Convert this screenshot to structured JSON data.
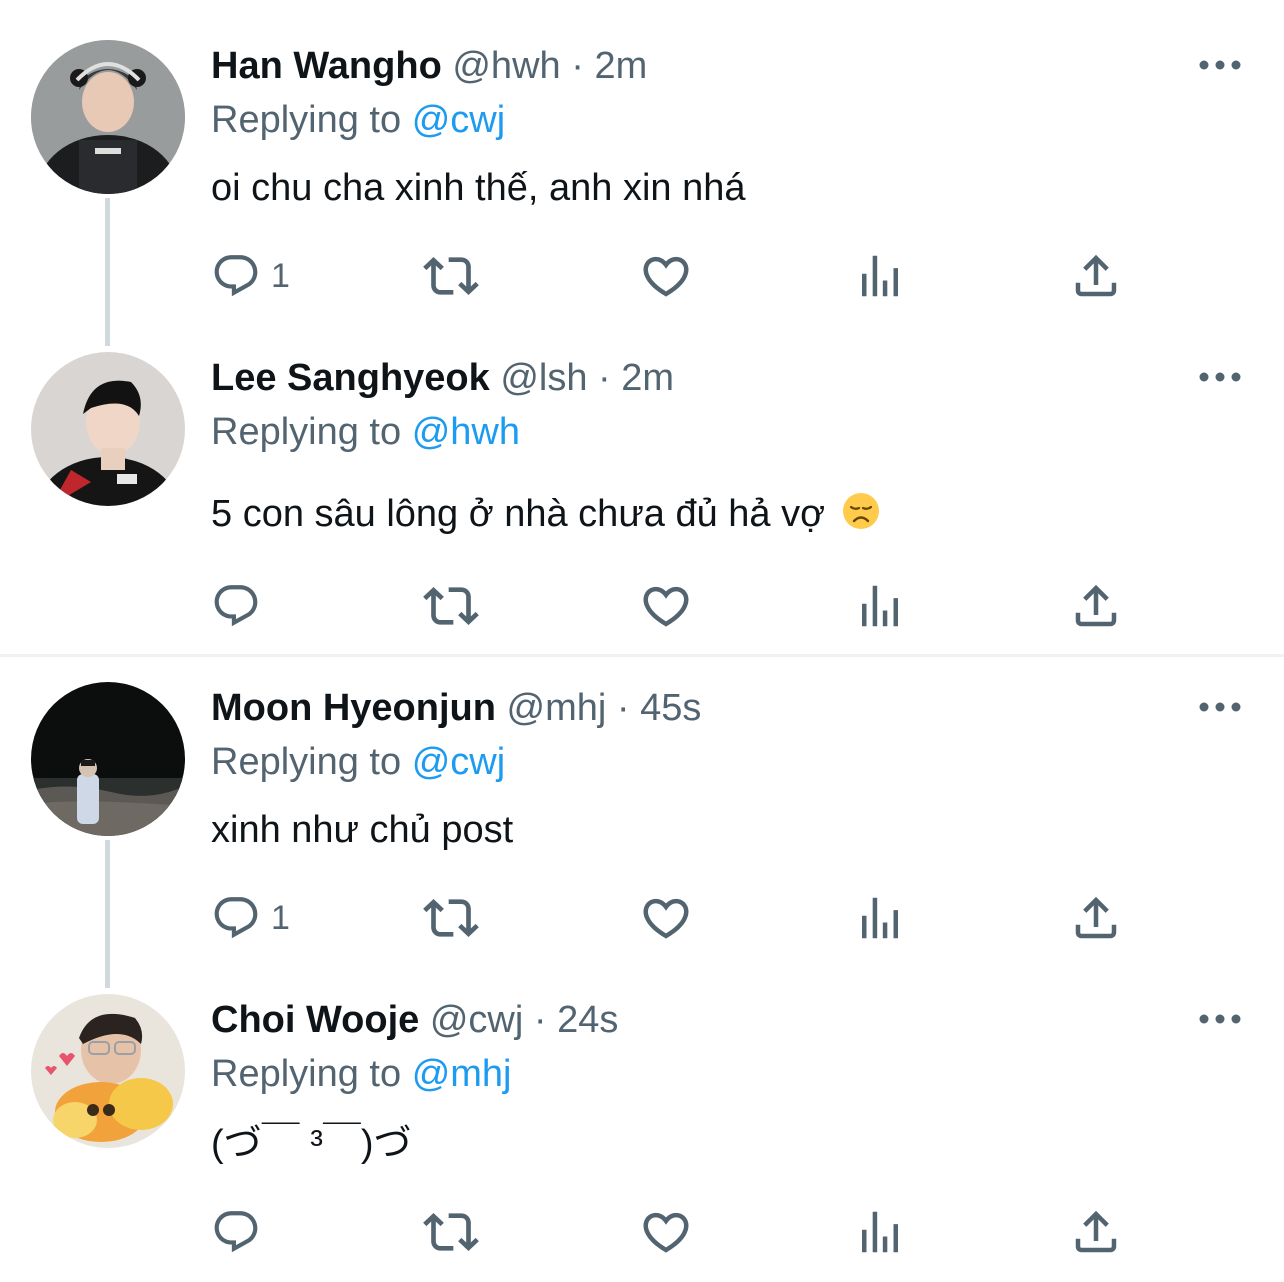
{
  "tweets": [
    {
      "name": "Han Wangho",
      "handle": "@hwh",
      "separator": "·",
      "time": "2m",
      "replying_label": "Replying to",
      "replying_to": "@cwj",
      "text": "oi chu cha xinh thế, anh xin nhá",
      "reply_count": "1"
    },
    {
      "name": "Lee Sanghyeok",
      "handle": "@lsh",
      "separator": "·",
      "time": "2m",
      "replying_label": "Replying to",
      "replying_to": "@hwh",
      "text": "5 con sâu lông ở nhà chưa đủ hả vợ",
      "emoji": "disappointed-face",
      "reply_count": ""
    },
    {
      "name": "Moon Hyeonjun",
      "handle": "@mhj",
      "separator": "·",
      "time": "45s",
      "replying_label": "Replying to",
      "replying_to": "@cwj",
      "text": "xinh như chủ post",
      "reply_count": "1"
    },
    {
      "name": "Choi Wooje",
      "handle": "@cwj",
      "separator": "·",
      "time": "24s",
      "replying_label": "Replying to",
      "replying_to": "@mhj",
      "text": "(づ￣ ³￣)づ",
      "reply_count": ""
    }
  ],
  "icons": {
    "reply": "reply-icon",
    "retweet": "retweet-icon",
    "like": "heart-icon",
    "views": "views-icon",
    "share": "share-icon",
    "more": "more-icon"
  },
  "colors": {
    "text": "#0f1419",
    "secondary": "#536471",
    "accent": "#1d9bf0",
    "thread_line": "#cfd9de",
    "divider": "#eff3f4"
  }
}
